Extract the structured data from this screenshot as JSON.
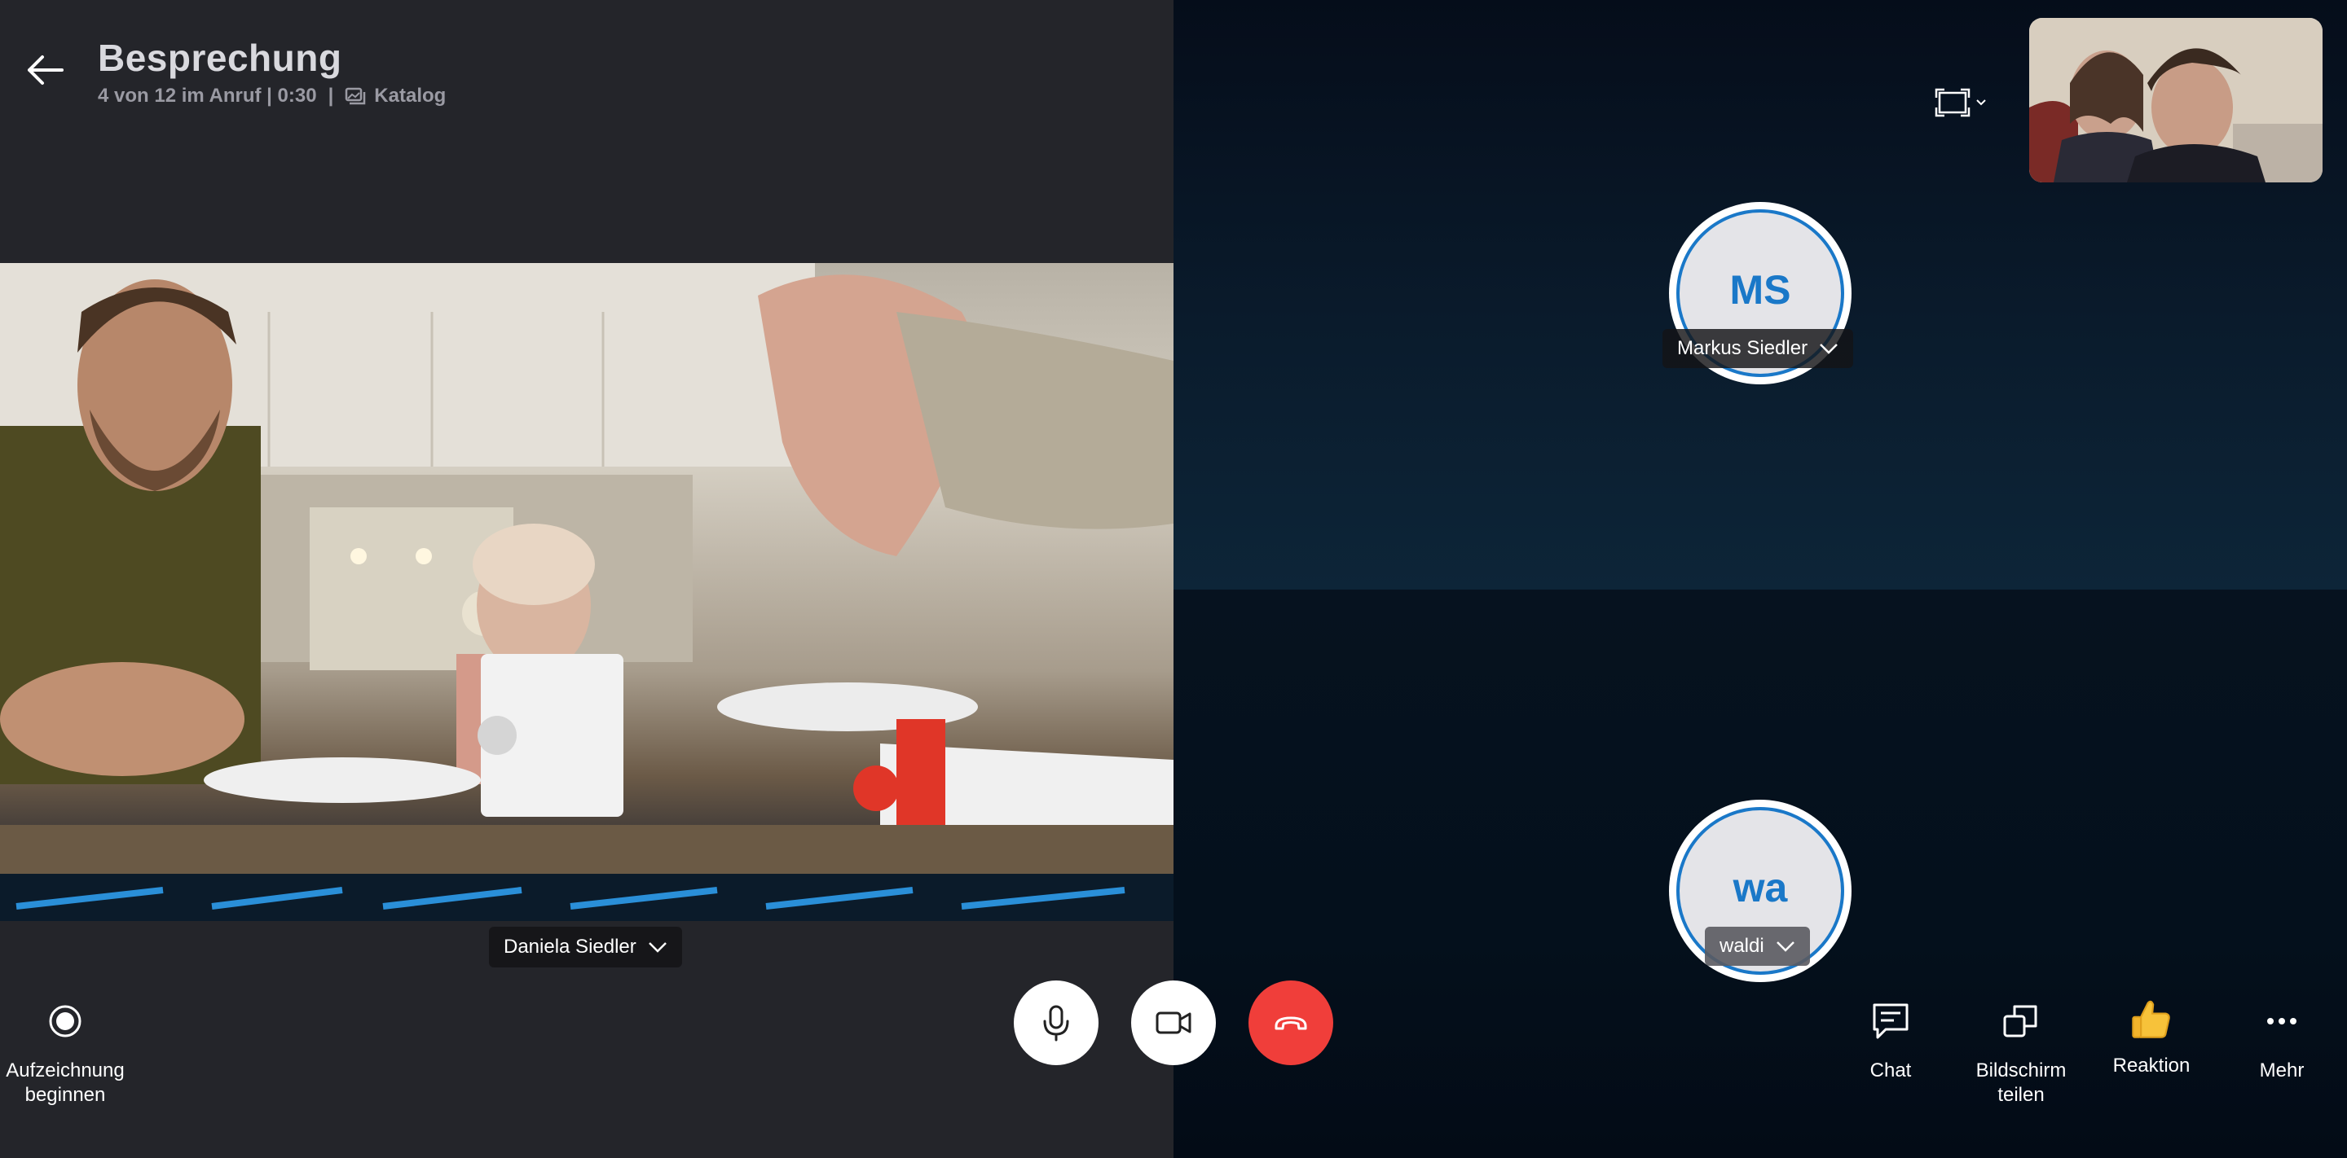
{
  "header": {
    "title": "Besprechung",
    "call_info": "4 von 12 im Anruf | 0:30",
    "separator": "|",
    "catalog_label": "Katalog"
  },
  "participants": {
    "main": {
      "name": "Daniela Siedler"
    },
    "tile_top": {
      "initials": "MS",
      "name": "Markus Siedler"
    },
    "tile_bottom": {
      "initials": "wa",
      "name": "waldi"
    }
  },
  "controls": {
    "record_label": "Aufzeichnung\nbeginnen",
    "chat_label": "Chat",
    "share_label": "Bildschirm\nteilen",
    "reaction_label": "Reaktion",
    "more_label": "Mehr"
  },
  "icons": {
    "back": "arrow-left-icon",
    "catalog": "gallery-icon",
    "layout": "layout-frame-icon",
    "record": "record-icon",
    "mic": "microphone-icon",
    "video": "video-camera-icon",
    "hangup": "hang-up-icon",
    "chat": "chat-bubble-icon",
    "share": "share-screen-icon",
    "reaction": "thumbs-up-icon",
    "more": "more-dots-icon"
  },
  "colors": {
    "accent": "#1a78c8",
    "hangup": "#f03e3a",
    "left_bg": "#24252a",
    "right_bg": "#0a1b2c"
  }
}
